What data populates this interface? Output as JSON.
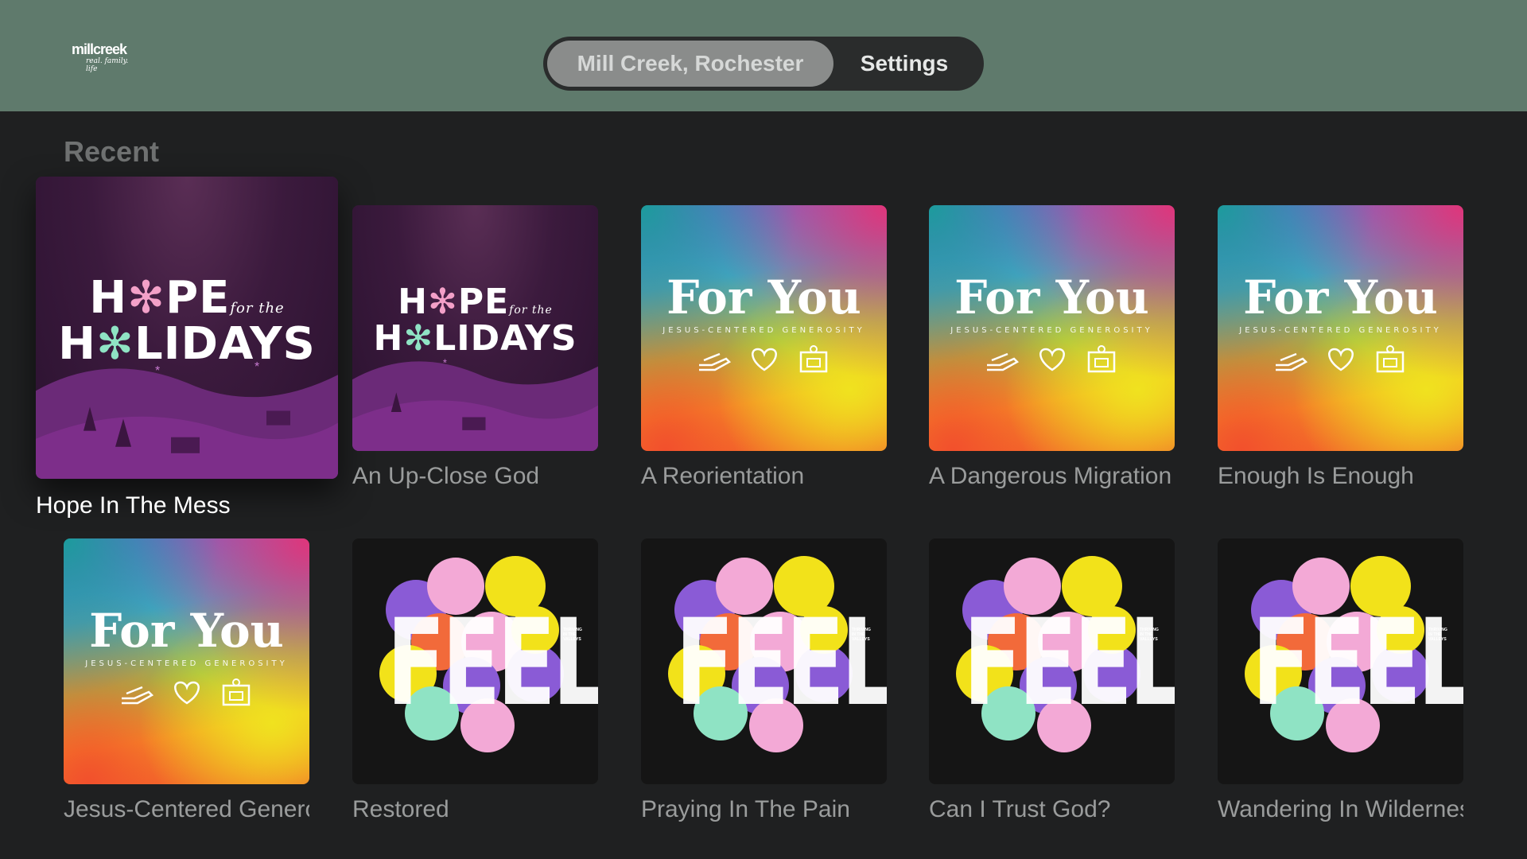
{
  "header": {
    "logo": {
      "line1": "millcreek",
      "line2": "real. family. life"
    },
    "tabs": [
      {
        "label": "Mill Creek, Rochester",
        "active": true
      },
      {
        "label": "Settings",
        "active": false
      }
    ]
  },
  "section": {
    "title": "Recent"
  },
  "artwork": {
    "hope": {
      "line1_a": "H",
      "line1_b": "PE",
      "for_the": "for the",
      "line2_a": "H",
      "line2_b": "LIDAYS"
    },
    "foryou": {
      "title": "For You",
      "subtitle": "JESUS-CENTERED GENEROSITY"
    },
    "feels": {
      "word": "FEELS",
      "tag": "THRIVING IN THE VALLEYS"
    }
  },
  "row1": [
    {
      "title": "Hope In The Mess",
      "art": "hope",
      "focused": true
    },
    {
      "title": "An Up-Close God",
      "art": "hope"
    },
    {
      "title": "A Reorientation",
      "art": "foryou"
    },
    {
      "title": "A Dangerous Migration",
      "art": "foryou"
    },
    {
      "title": "Enough Is Enough",
      "art": "foryou"
    }
  ],
  "row2": [
    {
      "title": "Jesus-Centered Generosity",
      "art": "foryou"
    },
    {
      "title": "Restored",
      "art": "feels"
    },
    {
      "title": "Praying In The Pain",
      "art": "feels"
    },
    {
      "title": "Can I Trust God?",
      "art": "feels"
    },
    {
      "title": "Wandering In Wilderness",
      "art": "feels"
    }
  ],
  "colors": {
    "topbar": "#5f7a6c",
    "background": "#1f2021",
    "hope_purple": "#3b1a3d",
    "feels_yellow": "#f2e21a",
    "feels_pink": "#f3a9d6",
    "feels_purple": "#8a5bd6",
    "feels_mint": "#8fe3c4",
    "feels_orange": "#f26a3a"
  }
}
